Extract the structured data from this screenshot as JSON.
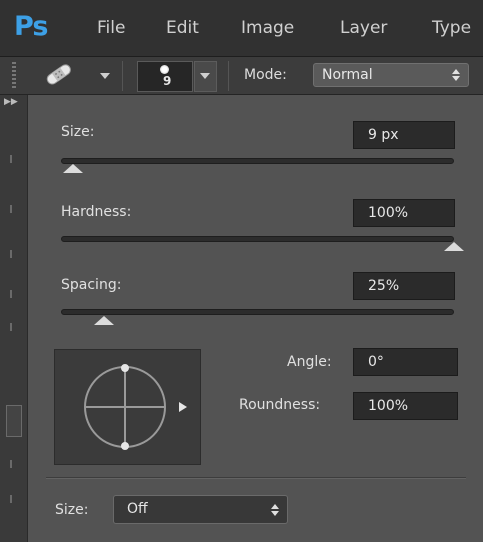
{
  "menubar": {
    "logo": "Ps",
    "items": [
      "File",
      "Edit",
      "Image",
      "Layer",
      "Type"
    ]
  },
  "options_bar": {
    "tool_icon": "bandage-icon",
    "brush_size": "9",
    "mode_label": "Mode:",
    "mode_value": "Normal"
  },
  "brush_panel": {
    "size": {
      "label": "Size:",
      "value": "9 px",
      "slider_fraction": 0.03
    },
    "hardness": {
      "label": "Hardness:",
      "value": "100%",
      "slider_fraction": 1.0
    },
    "spacing": {
      "label": "Spacing:",
      "value": "25%",
      "slider_fraction": 0.11
    },
    "angle": {
      "label": "Angle:",
      "value": "0°"
    },
    "roundness": {
      "label": "Roundness:",
      "value": "100%"
    },
    "size_control": {
      "label": "Size:",
      "value": "Off"
    }
  }
}
